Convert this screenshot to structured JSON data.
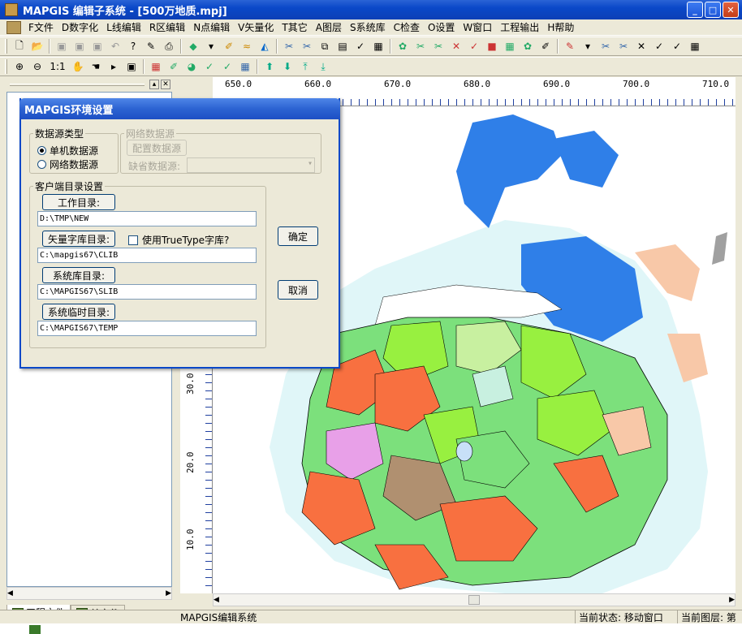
{
  "window": {
    "title": "MAPGIS 编辑子系统 - [500万地质.mpj]"
  },
  "menu": [
    "F文件",
    "D数字化",
    "L线编辑",
    "R区编辑",
    "N点编辑",
    "V矢量化",
    "T其它",
    "A图层",
    "S系统库",
    "C检查",
    "O设置",
    "W窗口",
    "工程输出",
    "H帮助"
  ],
  "ruler": {
    "x_labels": [
      "650.0",
      "660.0",
      "670.0",
      "680.0",
      "690.0",
      "700.0",
      "710.0"
    ],
    "y_labels": [
      "30.0",
      "20.0",
      "10.0"
    ]
  },
  "left_panel": {
    "tabs": [
      "工程文件",
      "单文件"
    ]
  },
  "status": {
    "app": "MAPGIS编辑系统",
    "state": "当前状态: 移动窗口",
    "layer": "当前图层: 第"
  },
  "dialog": {
    "title": "MAPGIS环境设置",
    "source_type": {
      "legend": "数据源类型",
      "options": [
        "单机数据源",
        "网络数据源"
      ],
      "selected": "单机数据源"
    },
    "network": {
      "legend": "网络数据源",
      "config_button": "配置数据源",
      "default_label": "缺省数据源:",
      "default_value": ""
    },
    "client": {
      "legend": "客户端目录设置",
      "work_dir": {
        "label": "工作目录:",
        "value": "D:\\TMP\\NEW"
      },
      "font_dir": {
        "label": "矢量字库目录:",
        "value": "C:\\mapgis67\\CLIB"
      },
      "truetype": {
        "label": "使用TrueType字库?",
        "checked": false
      },
      "slib_dir": {
        "label": "系统库目录:",
        "value": "C:\\MAPGIS67\\SLIB"
      },
      "temp_dir": {
        "label": "系统临时目录:",
        "value": "C:\\MAPGIS67\\TEMP"
      }
    },
    "ok": "确定",
    "cancel": "取消"
  }
}
